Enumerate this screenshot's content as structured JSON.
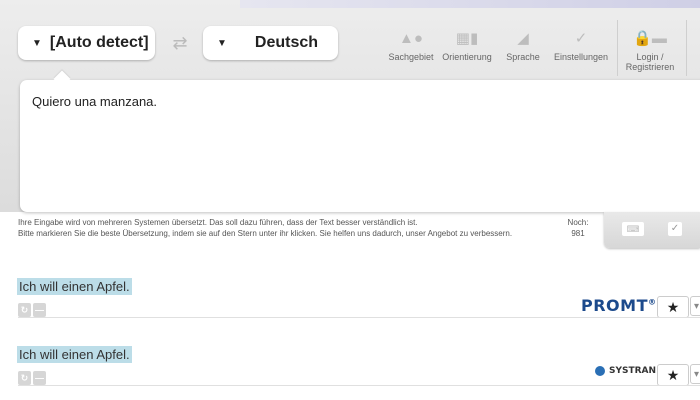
{
  "languages": {
    "source": "[Auto detect]",
    "target": "Deutsch"
  },
  "toolbar": [
    {
      "label": "Sachgebiet"
    },
    {
      "label": "Orientierung"
    },
    {
      "label": "Sprache"
    },
    {
      "label": "Einstellungen"
    },
    {
      "label": "Login / Registrieren"
    }
  ],
  "input": {
    "text": "Quiero una manzana."
  },
  "info": {
    "line1": "Ihre Eingabe wird von mehreren Systemen übersetzt. Das soll dazu führen, dass der Text besser verständlich ist.",
    "line2": "Bitte markieren Sie die beste Übersetzung, indem sie auf den Stern unter ihr klicken. Sie helfen uns dadurch, unser Angebot zu verbessern."
  },
  "counter": {
    "label": "Noch:",
    "value": "981"
  },
  "results": [
    {
      "text": "Ich will einen Apfel.",
      "engine": "PROMT",
      "engine_mark": "®"
    },
    {
      "text": "Ich will einen Apfel.",
      "engine": "SYSTRAN"
    }
  ],
  "colors": {
    "highlight": "#bcdde8",
    "promt_blue": "#1c4a8c"
  }
}
